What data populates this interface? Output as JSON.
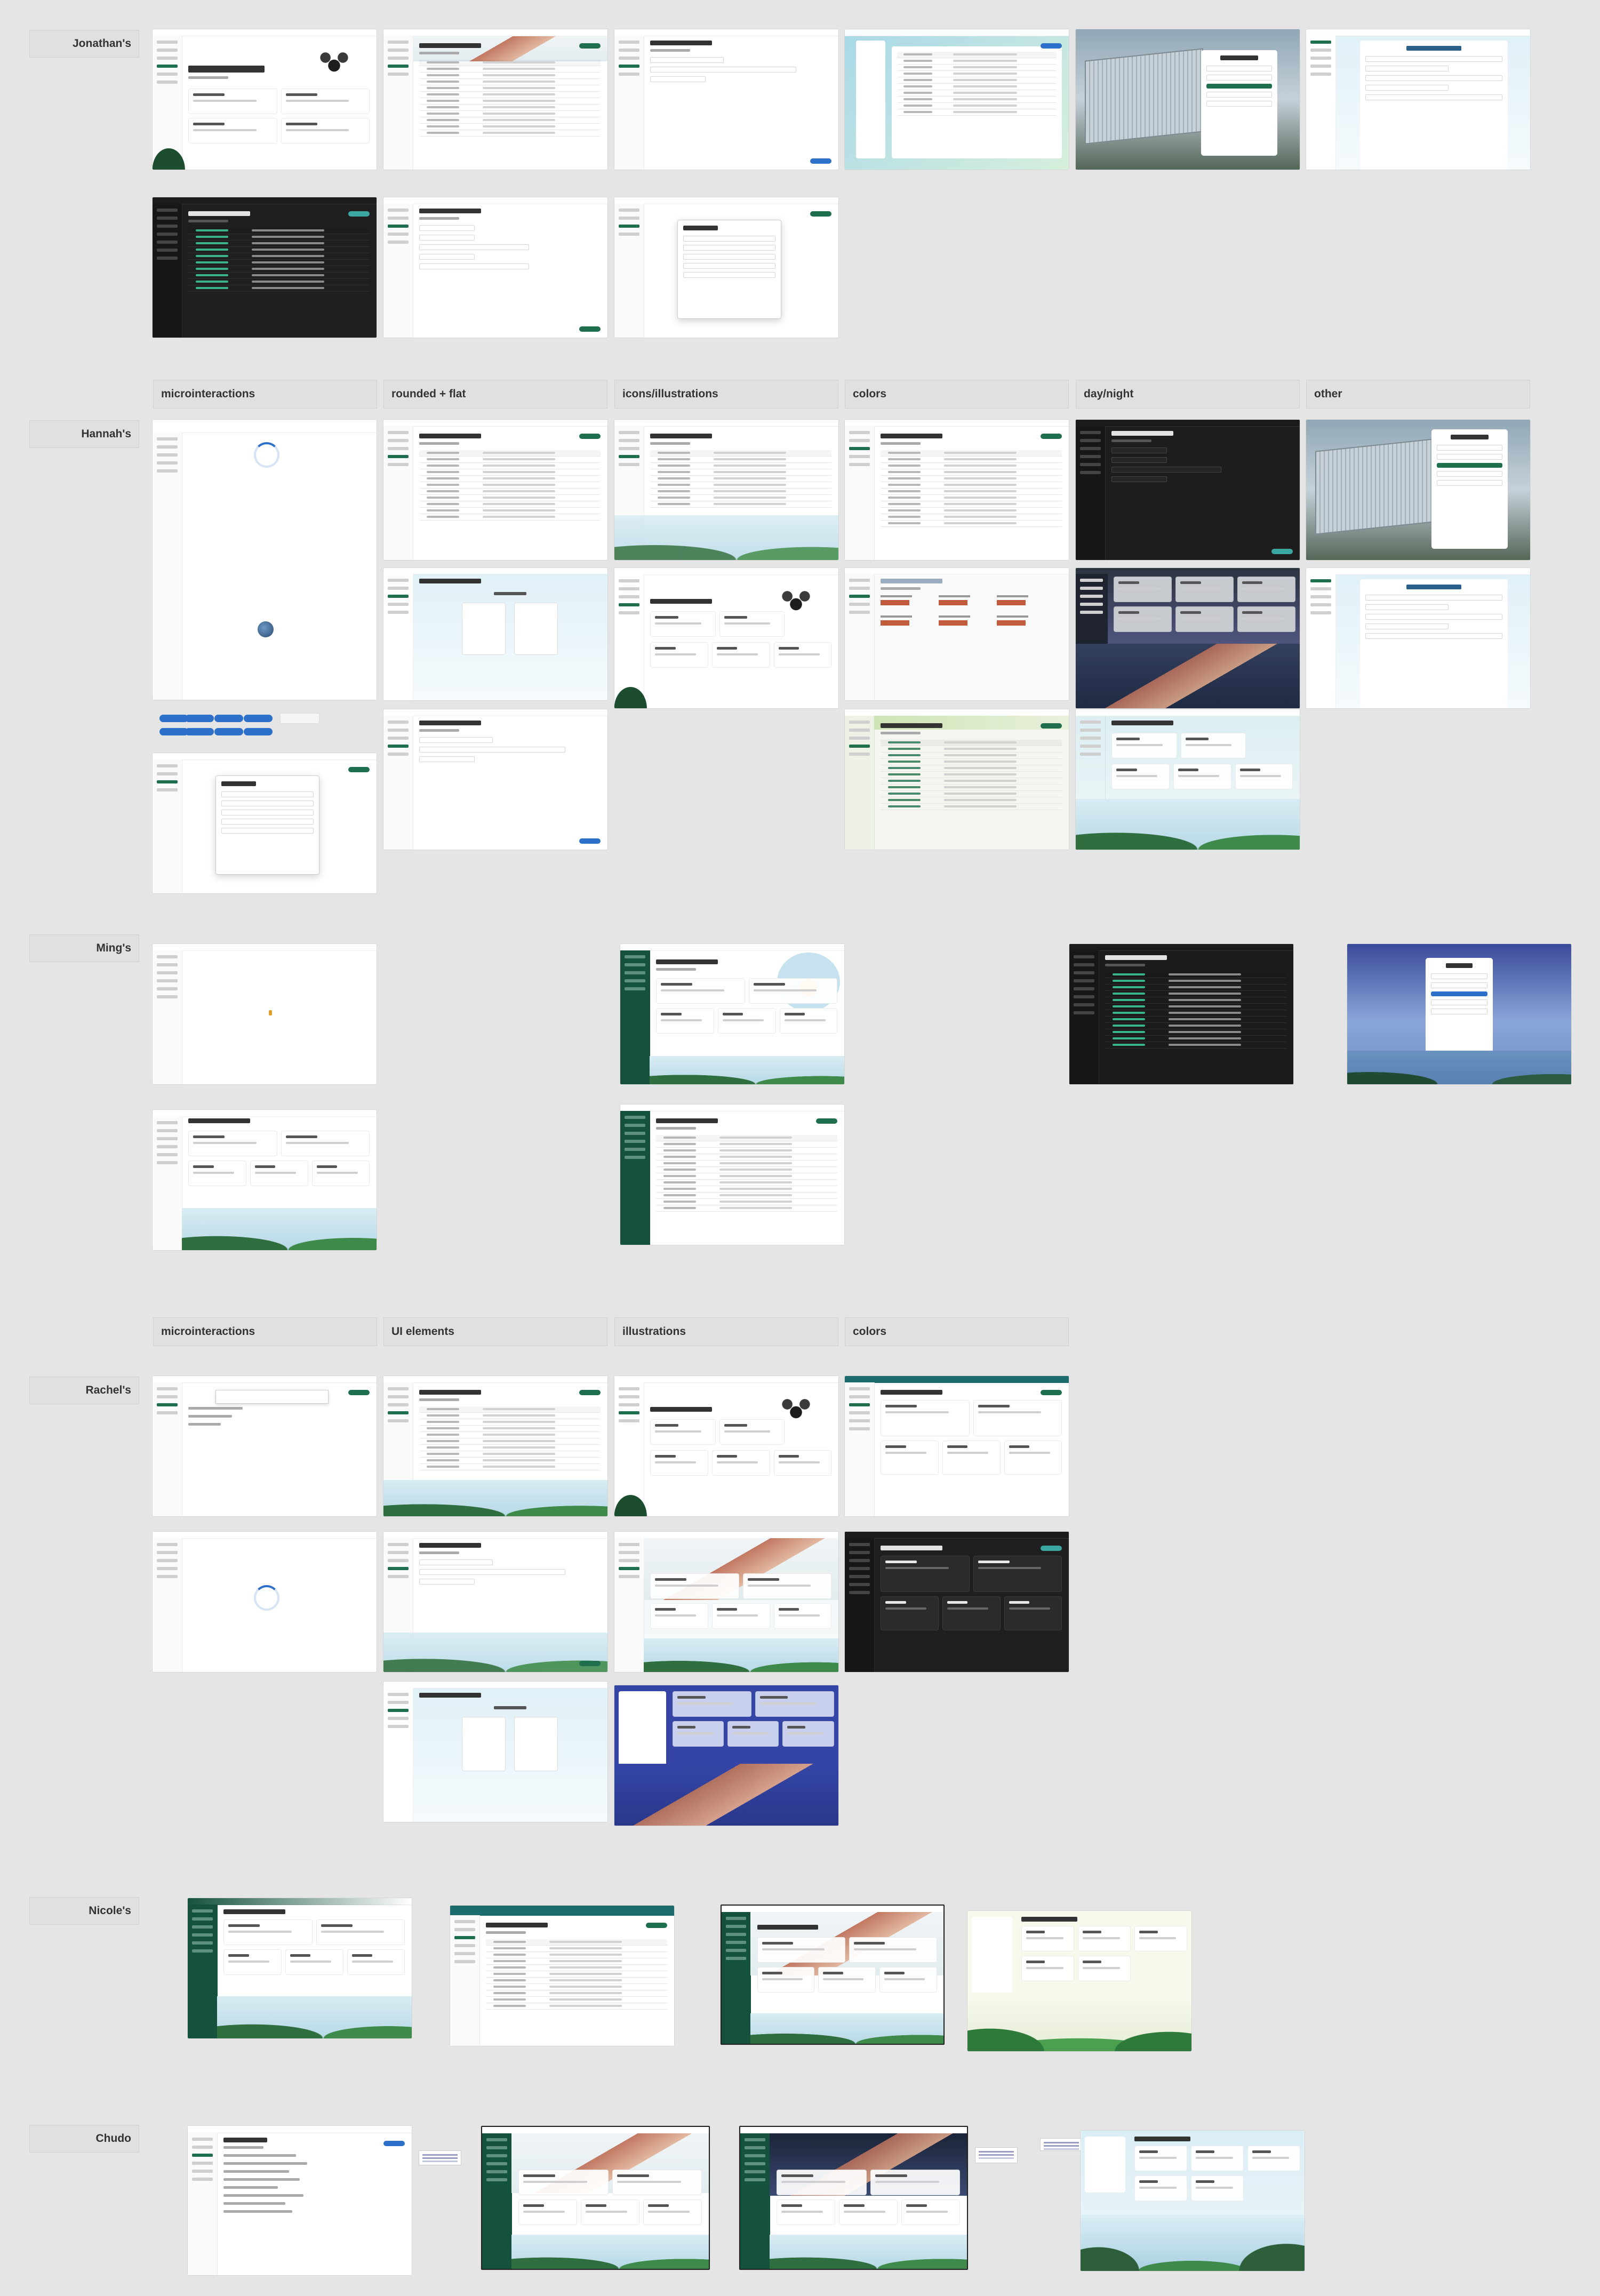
{
  "row_labels": {
    "jonathan": "Jonathan's",
    "hannah": "Hannah's",
    "ming": "Ming's",
    "rachel": "Rachel's",
    "nicole": "Nicole's",
    "chudo": "Chudo"
  },
  "hannah_categories": [
    "microinteractions",
    "rounded + flat",
    "icons/illustrations",
    "colors",
    "day/night",
    "other"
  ],
  "rachel_categories": [
    "microinteractions",
    "UI elements",
    "illustrations",
    "colors"
  ],
  "thumbnails": {
    "greeting": "Good morning, Clara",
    "people_title": "People",
    "accessions_title": "Accessions",
    "add_species": "Add Species",
    "species_title": "Species",
    "create_accession": "Create an Accession",
    "add_person": "Add Person",
    "login": "Login"
  },
  "colors": {
    "background": "#e5e5e5",
    "brand_green": "#1f6e4e",
    "accent_blue": "#2c70c9"
  }
}
